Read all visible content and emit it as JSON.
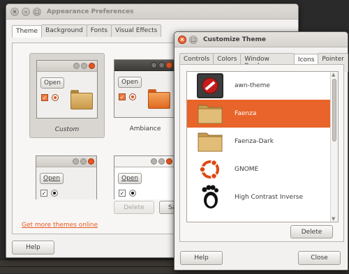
{
  "colors": {
    "accent": "#e8642a",
    "link": "#e8561f"
  },
  "main_window": {
    "title": "Appearance Preferences",
    "tabs": [
      {
        "label": "Theme",
        "active": true
      },
      {
        "label": "Background",
        "active": false
      },
      {
        "label": "Fonts",
        "active": false
      },
      {
        "label": "Visual Effects",
        "active": false
      }
    ],
    "themes": [
      {
        "name": "Custom",
        "preview_button": "Open",
        "selected": true
      },
      {
        "name": "Ambiance",
        "preview_button": "Open",
        "selected": false
      },
      {
        "name": "",
        "preview_button": "Open",
        "selected": false
      },
      {
        "name": "",
        "preview_button": "Open",
        "selected": false
      }
    ],
    "delete_button": "Delete",
    "save_button": "Save",
    "get_more_link": "Get more themes online",
    "help_button": "Help"
  },
  "dialog": {
    "title": "Customize Theme",
    "tabs": [
      {
        "label": "Controls",
        "active": false
      },
      {
        "label": "Colors",
        "active": false
      },
      {
        "label": "Window Border",
        "active": false
      },
      {
        "label": "Icons",
        "active": true
      },
      {
        "label": "Pointer",
        "active": false
      }
    ],
    "icon_themes": [
      {
        "label": "awn-theme",
        "icon": "no-entry-icon",
        "selected": false
      },
      {
        "label": "Faenza",
        "icon": "folder-icon",
        "selected": true
      },
      {
        "label": "Faenza-Dark",
        "icon": "folder-icon",
        "selected": false
      },
      {
        "label": "GNOME",
        "icon": "ubuntu-logo-icon",
        "selected": false
      },
      {
        "label": "High Contrast Inverse",
        "icon": "gnome-foot-icon",
        "selected": false
      }
    ],
    "delete_button": "Delete",
    "help_button": "Help",
    "close_button": "Close"
  }
}
